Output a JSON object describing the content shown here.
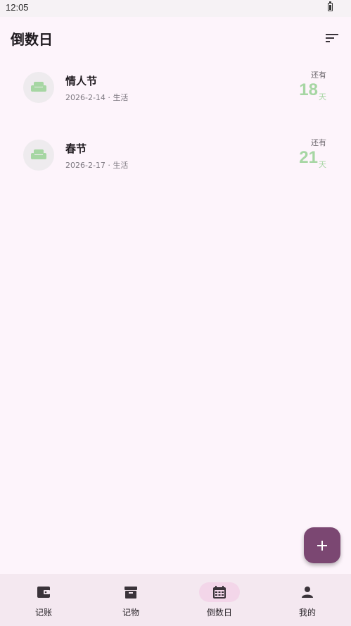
{
  "status_bar": {
    "time": "12:05",
    "battery_icon": "battery-icon"
  },
  "header": {
    "title": "倒数日",
    "sort_icon": "sort-icon"
  },
  "events": [
    {
      "name": "情人节",
      "date": "2026-2-14",
      "category": "生活",
      "remain_label": "还有",
      "days": "18",
      "unit": "天",
      "icon": "sofa-icon"
    },
    {
      "name": "春节",
      "date": "2026-2-17",
      "category": "生活",
      "remain_label": "还有",
      "days": "21",
      "unit": "天",
      "icon": "sofa-icon"
    }
  ],
  "fab": {
    "icon": "plus-icon"
  },
  "bottom_nav": {
    "items": [
      {
        "label": "记账",
        "icon": "wallet-icon",
        "active": false
      },
      {
        "label": "记物",
        "icon": "archive-icon",
        "active": false
      },
      {
        "label": "倒数日",
        "icon": "calendar-icon",
        "active": true
      },
      {
        "label": "我的",
        "icon": "person-icon",
        "active": false
      }
    ]
  },
  "colors": {
    "background": "#fdf4fb",
    "accent": "#7b4772",
    "days_green": "#a6d6a3",
    "nav_background": "#f4e8f0",
    "nav_active_pill": "#f3d6e9"
  }
}
